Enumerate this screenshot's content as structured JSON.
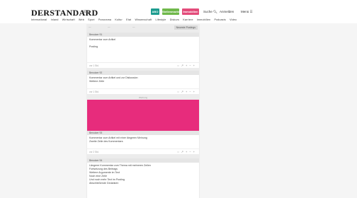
{
  "header": {
    "logo": "DERSTANDARD",
    "logo_sub": "Etat",
    "btn1": "ABO",
    "btn2": "Stellenmarkt",
    "btn3": "Immobilien",
    "search": "Suche",
    "login": "Anmelden",
    "menu": "Menü"
  },
  "nav": [
    "International",
    "Inland",
    "Wirtschaft",
    "Web",
    "Sport",
    "Panorama",
    "Kultur",
    "Etat",
    "Wissenschaft",
    "Lifestyle",
    "Diskurs",
    "Karriere",
    "Immobilien",
    "Podcasts",
    "Video"
  ],
  "tabs": {
    "left": [
      "—",
      "—",
      "—"
    ],
    "active": "Neueste Postings"
  },
  "posts": [
    {
      "user": "Benutzer 91",
      "body": [
        "Kommentar zum Artikel",
        "",
        "Posting"
      ],
      "time": "vor 1 Std."
    },
    {
      "user": "Benutzer 92",
      "body": [
        "Kommentar zum Artikel und zur Diskussion",
        "Weitere Zeile"
      ],
      "time": "vor 1 Std."
    },
    {
      "user": "Benutzer 93",
      "body": [
        "Kommentar zum Artikel mit einer längeren Meinung",
        "Zweite Zeile des Kommentars"
      ],
      "time": "vor 2 Std."
    },
    {
      "user": "Benutzer 94",
      "body": [
        "Längerer Kommentar zum Thema mit mehreren Zeilen",
        "Fortsetzung des Beitrags",
        "Weitere Argumente im Text",
        "Noch eine Zeile",
        "Und noch mehr Text im Posting",
        "Abschließende Gedanken"
      ],
      "time": ""
    }
  ],
  "ad_label": "Werbung",
  "actions": [
    "○",
    "↗",
    "+",
    "−",
    "+"
  ]
}
